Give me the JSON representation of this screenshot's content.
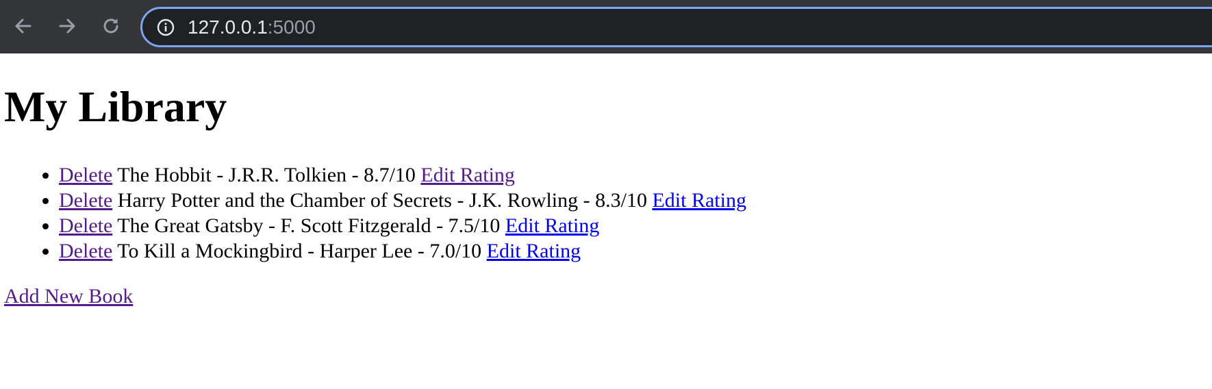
{
  "browser": {
    "url_host": "127.0.0.1",
    "url_port": ":5000",
    "icons": {
      "back": "arrow-left",
      "forward": "arrow-right",
      "reload": "reload",
      "site_info": "info-circle"
    }
  },
  "page": {
    "title": "My Library",
    "books": [
      {
        "delete_label": "Delete",
        "text": "The Hobbit - J.R.R. Tolkien - 8.7/10",
        "edit_label": "Edit Rating"
      },
      {
        "delete_label": "Delete",
        "text": "Harry Potter and the Chamber of Secrets - J.K. Rowling - 8.3/10",
        "edit_label": "Edit Rating"
      },
      {
        "delete_label": "Delete",
        "text": "The Great Gatsby - F. Scott Fitzgerald - 7.5/10",
        "edit_label": "Edit Rating"
      },
      {
        "delete_label": "Delete",
        "text": "To Kill a Mockingbird - Harper Lee - 7.0/10",
        "edit_label": "Edit Rating"
      }
    ],
    "add_label": "Add New Book"
  },
  "colors": {
    "toolbar": "#35363a",
    "omnibox": "#202124",
    "focus_ring": "#7fa4f7",
    "link": "#0000ee",
    "visited_link": "#551a8b"
  }
}
